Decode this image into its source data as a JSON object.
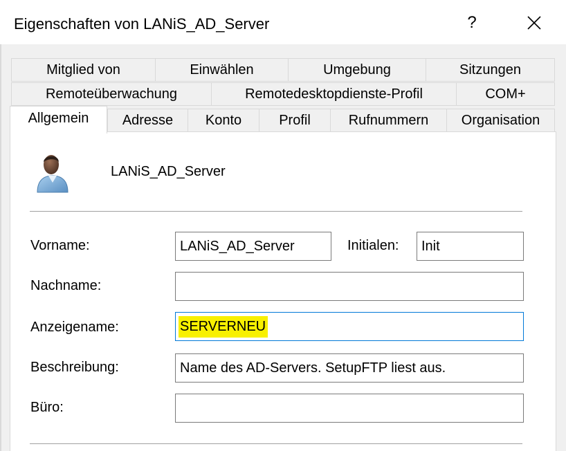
{
  "window": {
    "title": "Eigenschaften von LANiS_AD_Server",
    "help_label": "?"
  },
  "tabs": {
    "row1": [
      "Mitglied von",
      "Einwählen",
      "Umgebung",
      "Sitzungen"
    ],
    "row2": [
      "Remoteüberwachung",
      "Remotedesktopdienste-Profil",
      "COM+"
    ],
    "row3": [
      "Allgemein",
      "Adresse",
      "Konto",
      "Profil",
      "Rufnummern",
      "Organisation"
    ],
    "active": "Allgemein"
  },
  "general": {
    "object_name": "LANiS_AD_Server",
    "avatar_icon": "user-icon",
    "fields": {
      "vorname_label": "Vorname:",
      "vorname_value": "LANiS_AD_Server",
      "initialen_label": "Initialen:",
      "initialen_value": "Init",
      "nachname_label": "Nachname:",
      "nachname_value": "",
      "anzeigename_label": "Anzeigename:",
      "anzeigename_value": "SERVERNEU",
      "beschreibung_label": "Beschreibung:",
      "beschreibung_value": "Name des AD-Servers. SetupFTP liest aus.",
      "buero_label": "Büro:",
      "buero_value": ""
    }
  },
  "colors": {
    "highlight": "#f8f000",
    "focus_border": "#0078d7",
    "dialog_bg": "#f0f0f0"
  }
}
